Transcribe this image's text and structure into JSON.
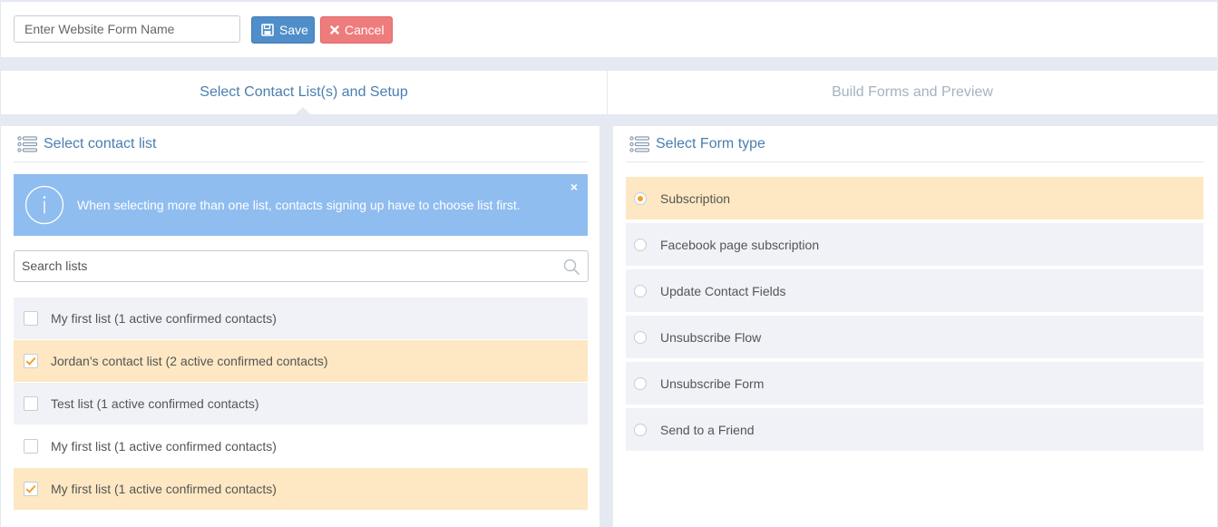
{
  "topbar": {
    "form_name_placeholder": "Enter Website Form Name",
    "form_name_value": "",
    "save_label": "Save",
    "cancel_label": "Cancel"
  },
  "tabs": [
    {
      "label": "Select Contact List(s) and Setup",
      "active": true
    },
    {
      "label": "Build Forms and Preview",
      "active": false
    }
  ],
  "contact_panel": {
    "title": "Select contact list",
    "alert_text": "When selecting more than one list, contacts signing up have to choose list first.",
    "alert_close": "×",
    "search_placeholder": "Search lists",
    "items": [
      {
        "label": "My first list (1 active confirmed contacts)",
        "checked": false
      },
      {
        "label": "Jordan’s contact list (2 active confirmed contacts)",
        "checked": true
      },
      {
        "label": "Test list (1 active confirmed contacts)",
        "checked": false
      },
      {
        "label": "My first list (1 active confirmed contacts)",
        "checked": false
      },
      {
        "label": "My first list (1 active confirmed contacts)",
        "checked": true
      }
    ]
  },
  "form_type_panel": {
    "title": "Select Form type",
    "types": [
      {
        "label": "Subscription",
        "selected": true
      },
      {
        "label": "Facebook page subscription",
        "selected": false
      },
      {
        "label": "Update Contact Fields",
        "selected": false
      },
      {
        "label": "Unsubscribe Flow",
        "selected": false
      },
      {
        "label": "Unsubscribe Form",
        "selected": false
      },
      {
        "label": "Send to a Friend",
        "selected": false
      }
    ]
  },
  "colors": {
    "accent": "#4a7eb0",
    "save_button": "#4f8ec9",
    "cancel_button": "#ee7c7c",
    "selected_row": "#fde8c3",
    "check_orange": "#f0a22e",
    "alert_bg": "#8fbdf0"
  },
  "icons": {
    "save": "floppy-disk-icon",
    "cancel": "close-icon",
    "list": "list-icon",
    "info": "info-icon",
    "search": "search-icon"
  }
}
